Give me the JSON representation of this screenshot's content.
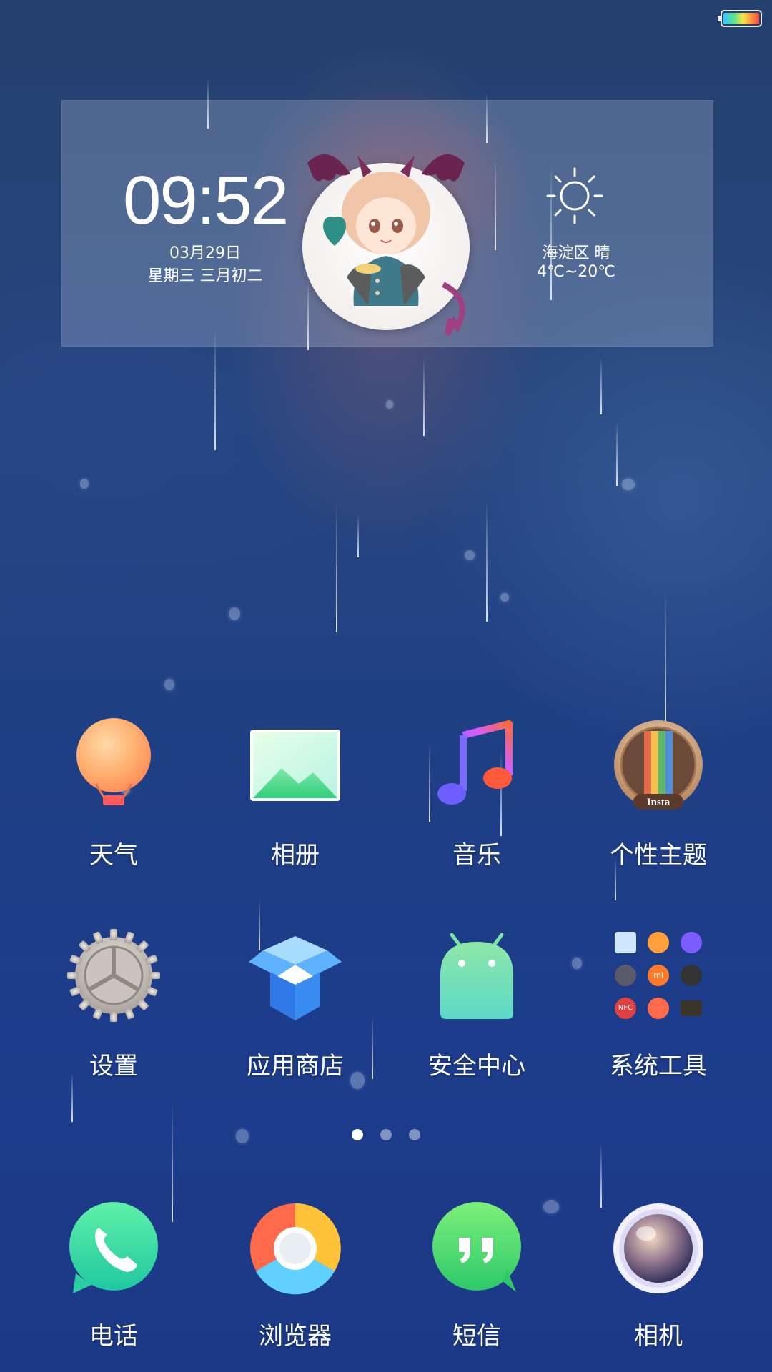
{
  "status_bar": {
    "battery_icon": "battery-icon",
    "battery_level": 1.0
  },
  "widget": {
    "time": "09:52",
    "date": "03月29日",
    "lunar_date": "星期三 三月初二",
    "weather_icon": "sun-icon",
    "location_weather": "海淀区 晴",
    "temperature": "4℃~20℃"
  },
  "apps": [
    {
      "label": "天气",
      "icon": "balloon-icon"
    },
    {
      "label": "相册",
      "icon": "gallery-icon"
    },
    {
      "label": "音乐",
      "icon": "music-note-icon"
    },
    {
      "label": "个性主题",
      "icon": "theme-icon"
    },
    {
      "label": "设置",
      "icon": "gear-icon"
    },
    {
      "label": "应用商店",
      "icon": "app-store-box-icon"
    },
    {
      "label": "安全中心",
      "icon": "android-icon"
    },
    {
      "label": "系统工具",
      "icon": "tools-folder-icon"
    }
  ],
  "theme_badge": "Insta",
  "tools_folder": {
    "nfc_label": "NFC",
    "mi_label": "mi"
  },
  "page_indicator": {
    "count": 3,
    "active": 1
  },
  "dock": [
    {
      "label": "电话",
      "icon": "phone-icon"
    },
    {
      "label": "浏览器",
      "icon": "browser-icon"
    },
    {
      "label": "短信",
      "icon": "message-icon"
    },
    {
      "label": "相机",
      "icon": "camera-icon"
    }
  ],
  "colors": {
    "accent_green": "#3fdc8f",
    "background_blue": "#1f3f85"
  }
}
